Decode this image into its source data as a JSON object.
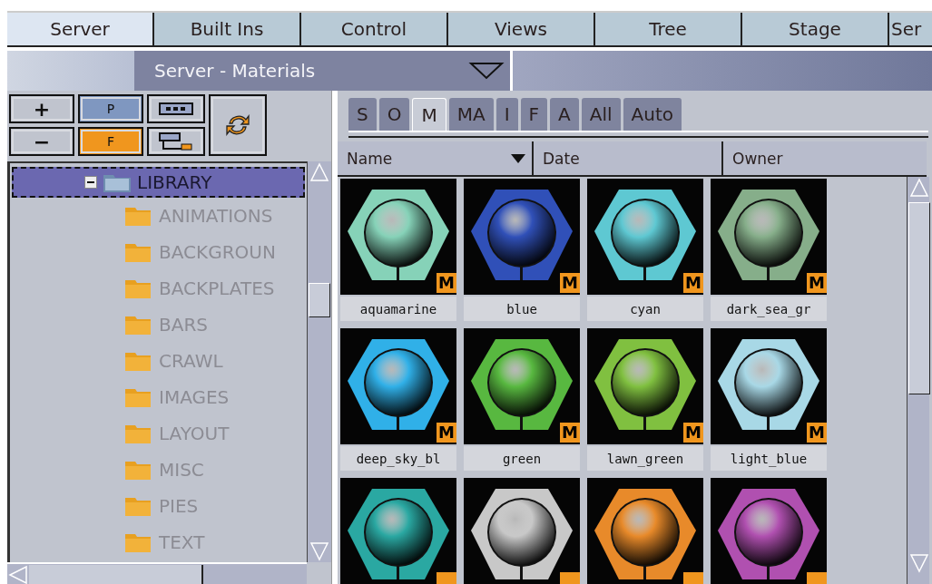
{
  "top_tabs": [
    {
      "label": "Server",
      "selected": true
    },
    {
      "label": "Built Ins",
      "selected": false
    },
    {
      "label": "Control",
      "selected": false
    },
    {
      "label": "Views",
      "selected": false
    },
    {
      "label": "Tree",
      "selected": false
    },
    {
      "label": "Stage",
      "selected": false
    },
    {
      "label": "Ser",
      "selected": false
    }
  ],
  "dropdown": {
    "value": "Server - Materials"
  },
  "toolbar": {
    "add": "+",
    "remove": "−",
    "page": "P",
    "folder": "F"
  },
  "tree": {
    "label": "LIBRARY",
    "expanded": true,
    "selected": true,
    "children": [
      {
        "label": "ANIMATIONS"
      },
      {
        "label": "BACKGROUN"
      },
      {
        "label": "BACKPLATES"
      },
      {
        "label": "BARS"
      },
      {
        "label": "CRAWL"
      },
      {
        "label": "IMAGES"
      },
      {
        "label": "LAYOUT"
      },
      {
        "label": "MISC"
      },
      {
        "label": "PIES"
      },
      {
        "label": "TEXT"
      }
    ]
  },
  "filter_tabs": [
    {
      "label": "S",
      "selected": false
    },
    {
      "label": "O",
      "selected": false
    },
    {
      "label": "M",
      "selected": true
    },
    {
      "label": "MA",
      "selected": false
    },
    {
      "label": "I",
      "selected": false
    },
    {
      "label": "F",
      "selected": false
    },
    {
      "label": "A",
      "selected": false
    },
    {
      "label": "All",
      "selected": false
    },
    {
      "label": "Auto",
      "selected": false
    }
  ],
  "columns": [
    {
      "label": "Name",
      "sorted": true
    },
    {
      "label": "Date",
      "sorted": false
    },
    {
      "label": "Owner",
      "sorted": false
    }
  ],
  "materials": [
    {
      "name": "aquamarine",
      "color": "#86d2b8",
      "badge": "M"
    },
    {
      "name": "blue",
      "color": "#3050b8",
      "badge": "M"
    },
    {
      "name": "cyan",
      "color": "#5ec8d2",
      "badge": "M"
    },
    {
      "name": "dark_sea_gr",
      "color": "#86ae8a",
      "badge": "M"
    },
    {
      "name": "deep_sky_bl",
      "color": "#30b0e8",
      "badge": "M"
    },
    {
      "name": "green",
      "color": "#58b840",
      "badge": "M"
    },
    {
      "name": "lawn_green",
      "color": "#80c040",
      "badge": "M"
    },
    {
      "name": "light_blue",
      "color": "#a8d8e6",
      "badge": "M"
    },
    {
      "color": "#2aa8a2"
    },
    {
      "color": "#c8c8c8"
    },
    {
      "color": "#e88a2a"
    },
    {
      "color": "#b050b0"
    }
  ]
}
